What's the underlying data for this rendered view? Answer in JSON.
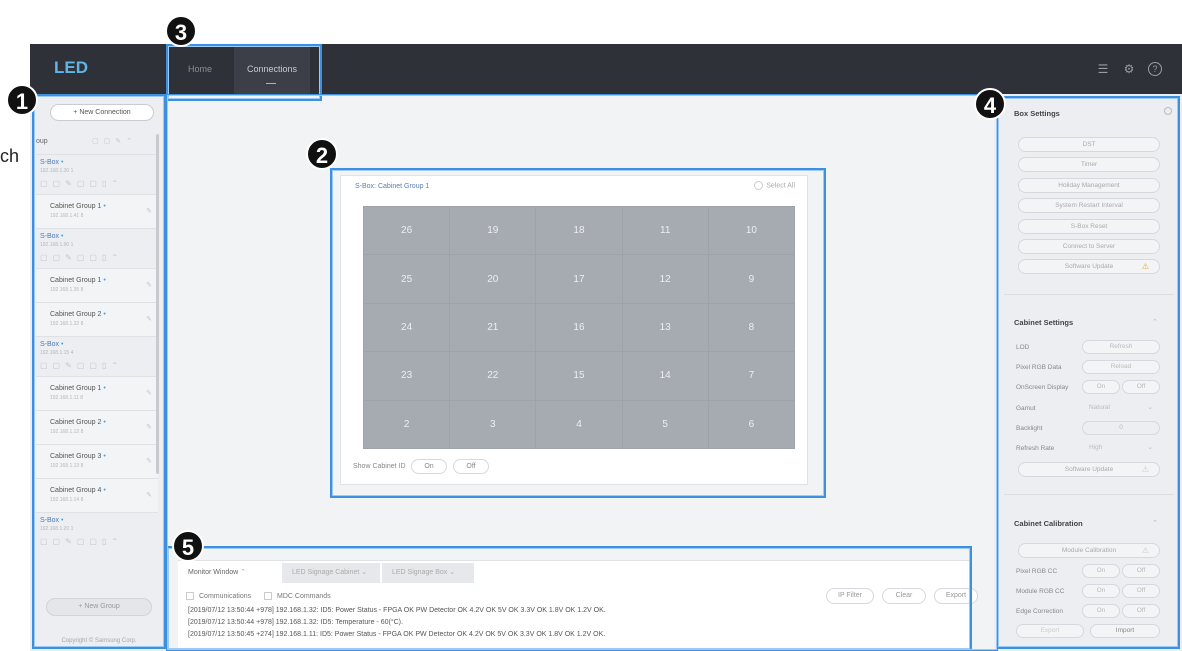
{
  "app": {
    "logo": "LED",
    "tabs": {
      "home": "Home",
      "connections": "Connections"
    },
    "toolbar_icons": [
      "sliders-icon",
      "gear-icon",
      "help-icon"
    ]
  },
  "sidebar": {
    "new_connection": "+ New Connection",
    "group_label": "oup",
    "items": [
      {
        "kind": "sbox",
        "name": "S-Box",
        "ip": "192.168.1.30 1"
      },
      {
        "kind": "cabinet",
        "name": "Cabinet Group 1",
        "ip": "192.168.1.41 8"
      },
      {
        "kind": "sbox",
        "name": "S-Box",
        "ip": "192.168.1.90 1"
      },
      {
        "kind": "cabinet",
        "name": "Cabinet Group 1",
        "ip": "192.168.1.35 8"
      },
      {
        "kind": "cabinet",
        "name": "Cabinet Group 2",
        "ip": "192.168.1.32 8"
      },
      {
        "kind": "sbox",
        "name": "S-Box",
        "ip": "192.168.1.15 4"
      },
      {
        "kind": "cabinet",
        "name": "Cabinet Group 1",
        "ip": "192.168.1.11 8"
      },
      {
        "kind": "cabinet",
        "name": "Cabinet Group 2",
        "ip": "192.168.1.12 8"
      },
      {
        "kind": "cabinet",
        "name": "Cabinet Group 3",
        "ip": "192.168.1.13 8"
      },
      {
        "kind": "cabinet",
        "name": "Cabinet Group 4",
        "ip": "192.168.1.14 8"
      },
      {
        "kind": "sbox",
        "name": "S-Box",
        "ip": "192.168.1.20 1"
      }
    ],
    "new_group": "+ New Group",
    "copyright": "Copyright © Samsung Corp."
  },
  "cabinet_view": {
    "title": "S-Box: Cabinet Group 1",
    "select_all": "Select All",
    "cabinet_ids": [
      "26",
      "19",
      "18",
      "11",
      "10",
      "25",
      "20",
      "17",
      "12",
      "9",
      "24",
      "21",
      "16",
      "13",
      "8",
      "23",
      "22",
      "15",
      "14",
      "7",
      "2",
      "3",
      "4",
      "5",
      "6"
    ],
    "show_cabinet_id": "Show Cabinet ID",
    "on": "On",
    "off": "Off"
  },
  "monitor": {
    "tabs": [
      "Monitor Window",
      "LED Signage Cabinet",
      "LED Signage Box"
    ],
    "communications": "Communications",
    "mdc_commands": "MDC Commands",
    "ip_filter": "IP Filter",
    "clear": "Clear",
    "export": "Export",
    "logs": [
      "[2019/07/12 13:50:44 +978] 192.168.1.32: ID5: Power Status - FPGA OK PW Detector OK 4.2V OK 5V OK 3.3V OK 1.8V OK 1.2V OK.",
      "[2019/07/12 13:50:44 +978] 192.168.1.32: ID5: Temperature - 60(°C).",
      "[2019/07/12 13:50:45 +274] 192.168.1.11: ID5: Power Status - FPGA OK PW Detector OK 4.2V OK 5V OK 3.3V OK 1.8V OK 1.2V OK."
    ]
  },
  "right_panel": {
    "box_settings": "Box Settings",
    "box_buttons": [
      "DST",
      "Timer",
      "Holiday Management",
      "System Restart Interval",
      "S-Box Reset",
      "Connect to Server",
      "Software Update"
    ],
    "cabinet_settings": "Cabinet Settings",
    "settings_rows": [
      {
        "label": "LOD",
        "control": "Refresh"
      },
      {
        "label": "Pixel RGB Data",
        "control": "Reload"
      },
      {
        "label": "OnScreen Display",
        "on": "On",
        "off": "Off"
      },
      {
        "label": "Gamut",
        "control": "Natural"
      },
      {
        "label": "Backlight",
        "control": "0"
      },
      {
        "label": "Refresh Rate",
        "control": "High"
      }
    ],
    "cab_software_update": "Software Update",
    "cabinet_calibration": "Cabinet Calibration",
    "module_calibration": "Module Calibration",
    "calib_rows": [
      {
        "label": "Pixel RGB CC",
        "on": "On",
        "off": "Off"
      },
      {
        "label": "Module RGB CC",
        "on": "On",
        "off": "Off"
      },
      {
        "label": "Edge Correction",
        "on": "On",
        "off": "Off"
      }
    ],
    "export": "Export",
    "import": "Import"
  },
  "callouts": {
    "badge1": "1",
    "badge2": "2",
    "badge3": "3",
    "badge4": "4",
    "badge5": "5",
    "partial_text": "ch"
  },
  "colors": {
    "highlight": "#3d8fe0",
    "topbar": "#2f3138",
    "cabinet_cell": "#a6abb2",
    "warning": "#e7a33c"
  }
}
